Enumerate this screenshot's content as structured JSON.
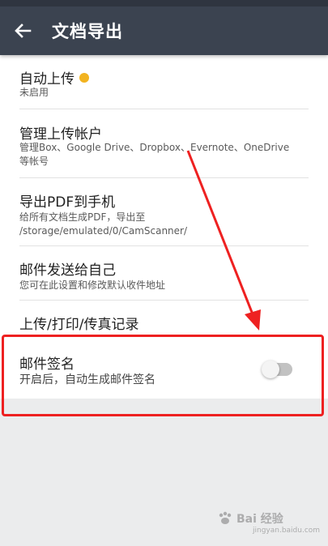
{
  "toolbar": {
    "title": "文档导出",
    "back_icon": "arrow-left-icon"
  },
  "items": [
    {
      "title": "自动上传",
      "subtitle": "未启用",
      "badge_icon": "crown-icon"
    },
    {
      "title": "管理上传帐户",
      "subtitle_line1": "管理Box、Google Drive、Dropbox、Evernote、OneDrive",
      "subtitle_line2": "等帐号"
    },
    {
      "title": "导出PDF到手机",
      "subtitle_line1": "给所有文档生成PDF，导出至",
      "subtitle_line2": "/storage/emulated/0/CamScanner/"
    },
    {
      "title": "邮件发送给自己",
      "subtitle": "您可在此设置和修改默认收件地址"
    },
    {
      "title": "上传/打印/传真记录"
    },
    {
      "title": "邮件签名",
      "subtitle": "开启后，自动生成邮件签名",
      "toggle_on": false
    }
  ],
  "colors": {
    "toolbar_bg": "#3b4350",
    "annotation_red": "#ee2121",
    "crown": "#f2b320"
  },
  "watermark": {
    "text": "Bai 经验",
    "url": "jingyan.baidu.com"
  }
}
